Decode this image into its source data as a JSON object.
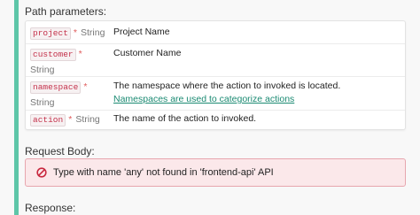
{
  "path_parameters": {
    "heading": "Path parameters:",
    "rows": [
      {
        "name": "project",
        "required_mark": "*",
        "type": "String",
        "description": "Project Name"
      },
      {
        "name": "customer",
        "required_mark": "*",
        "type": "String",
        "description": "Customer Name"
      },
      {
        "name": "namespace",
        "required_mark": "*",
        "type": "String",
        "description": "The namespace where the action to invoked is located.",
        "link_text": "Namespaces are used to categorize actions"
      },
      {
        "name": "action",
        "required_mark": "*",
        "type": "String",
        "description": "The name of the action to invoked."
      }
    ]
  },
  "request_body": {
    "heading": "Request Body:",
    "error_message": "Type with name 'any' not found in 'frontend-api' API",
    "error_icon": "ban-icon"
  },
  "response": {
    "heading": "Response:"
  },
  "colors": {
    "accent": "#5ec6a8",
    "link": "#1a8a72",
    "code_text": "#c4314b",
    "required": "#e05b5b",
    "error_bg": "#fbe8ea",
    "error_border": "#e7a6ae",
    "error_icon": "#c8283f"
  }
}
